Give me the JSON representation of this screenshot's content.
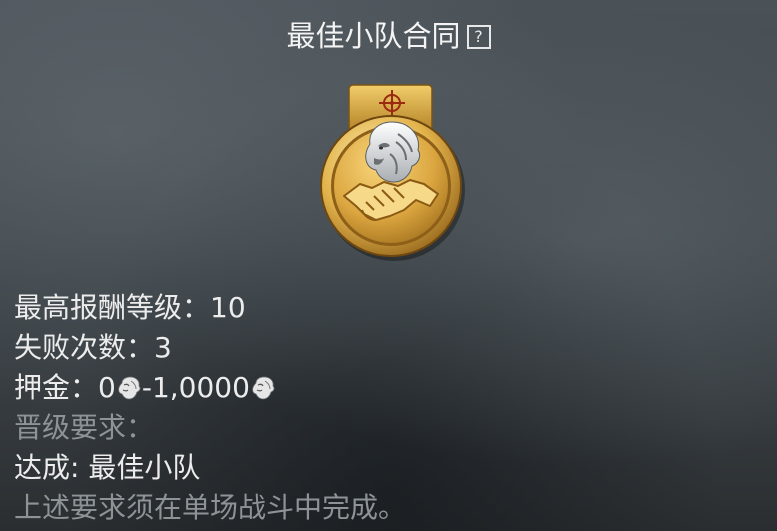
{
  "title": "最佳小队合同",
  "help_icon_glyph": "?",
  "stats": {
    "max_reward_level_label": "最高报酬等级：",
    "max_reward_level_value": "10",
    "failures_label": "失败次数：",
    "failures_value": "3",
    "deposit_label": "押金：",
    "deposit_min": "0",
    "deposit_separator": "-",
    "deposit_max": "1,0000",
    "deposit_currency_icon": "lion-coin-icon"
  },
  "requirements": {
    "heading": "晋级要求：",
    "achieve_label": "达成: ",
    "achieve_value": "最佳小队",
    "note": "上述要求须在单场战斗中完成。"
  },
  "colors": {
    "gold": "#d9a93a",
    "muted_text": "#8d9397",
    "text": "#ececec"
  }
}
